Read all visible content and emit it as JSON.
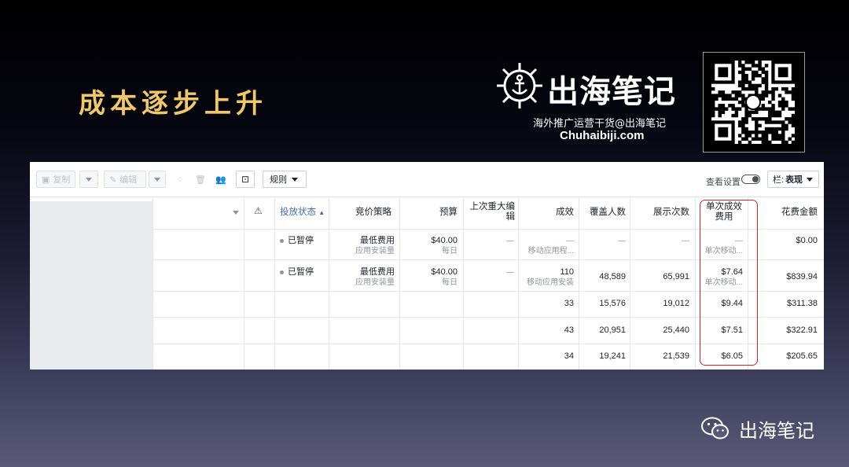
{
  "slide": {
    "title": "成本逐步上升",
    "brand_name": "出海笔记",
    "brand_slogan": "海外推广运营干货@出海笔记",
    "brand_url": "Chuhaibiji.com",
    "footer_brand": "出海笔记"
  },
  "toolbar": {
    "copy_label": "复制",
    "edit_label": "编辑",
    "rules_label": "规则",
    "view_settings_label": "查看设置",
    "columns_prefix": "栏:",
    "columns_value": "表现"
  },
  "table": {
    "headers": {
      "status": "投放状态",
      "bid_strategy": "竞价策略",
      "budget": "预算",
      "last_edit_line1": "上次重大编",
      "last_edit_line2": "辑",
      "results": "成效",
      "reach": "覆盖人数",
      "impressions": "展示次数",
      "cpr_line1": "单次成效",
      "cpr_line2": "费用",
      "spent": "花费金额"
    },
    "rows": [
      {
        "status": "已暂停",
        "bid": "最低费用",
        "bid_sub": "应用安装量",
        "budget": "$40.00",
        "budget_sub": "每日",
        "last_edit": "—",
        "results": "—",
        "results_sub": "移动应用程...",
        "reach": "—",
        "impressions": "—",
        "cpr": "—",
        "cpr_sub": "单次移动...",
        "spent": "$0.00"
      },
      {
        "status": "已暂停",
        "bid": "最低费用",
        "bid_sub": "应用安装量",
        "budget": "$40.00",
        "budget_sub": "每日",
        "last_edit": "—",
        "results": "110",
        "results_sub": "移动应用安装",
        "reach": "48,589",
        "impressions": "65,991",
        "cpr": "$7.64",
        "cpr_sub": "单次移动...",
        "spent": "$839.94"
      },
      {
        "results": "33",
        "reach": "15,576",
        "impressions": "19,012",
        "cpr": "$9.44",
        "spent": "$311.38"
      },
      {
        "results": "43",
        "reach": "20,951",
        "impressions": "25,440",
        "cpr": "$7.51",
        "spent": "$322.91"
      },
      {
        "results": "34",
        "reach": "19,241",
        "impressions": "21,539",
        "cpr": "$6.05",
        "spent": "$205.65"
      }
    ]
  },
  "colors": {
    "title_gold": "#f0c866",
    "highlight_red": "#e02020",
    "link_blue": "#4267b2"
  },
  "icons": {
    "brand_logo": "ship-wheel-anchor-icon",
    "qr": "qr-code",
    "footer_logo": "wechat-icon",
    "warning": "warning-icon"
  }
}
